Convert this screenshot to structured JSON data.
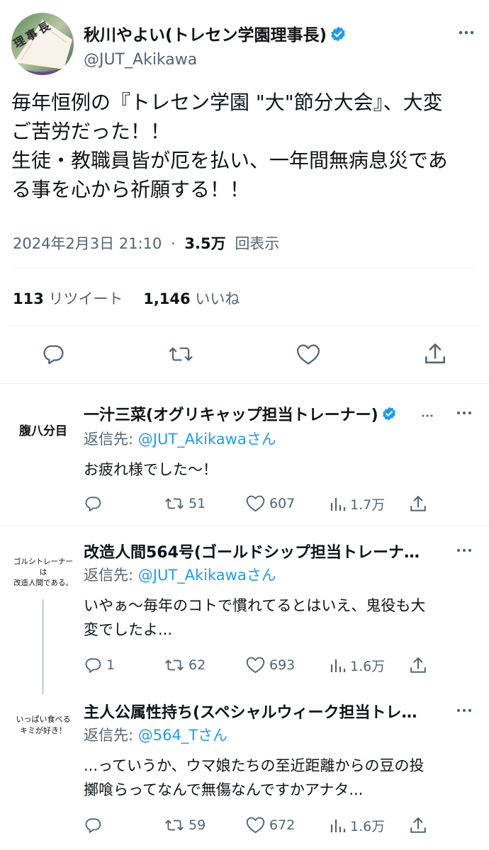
{
  "main_tweet": {
    "author_name": "秋川やよい(トレセン学園理事長)",
    "handle": "@JUT_Akikawa",
    "avatar_text": "理事長",
    "text_lines": [
      "毎年恒例の『トレセン学園 \"大\"節分大会』、大変",
      "ご苦労だった！！",
      "生徒・教職員皆が厄を払い、一年間無病息災であ",
      "る事を心から祈願する！！"
    ],
    "timestamp": "2024年2月3日 21:10",
    "separator": "·",
    "views_count": "3.5万",
    "views_label": "回表示",
    "retweets_count": "113",
    "retweets_label": "リツイート",
    "likes_count": "1,146",
    "likes_label": "いいね"
  },
  "replies": [
    {
      "author_name": "一汁三菜(オグリキャップ担当トレーナー)",
      "verified": true,
      "avatar_text": "腹八分目",
      "reply_prefix": "返信先: ",
      "reply_to": "@JUT_Akikawaさん",
      "text_lines": [
        "お疲れ様でした〜！"
      ],
      "replies": "",
      "retweets": "51",
      "likes": "607",
      "views": "1.7万"
    },
    {
      "author_name": "改造人間564号(ゴールドシップ担当トレーナ…",
      "verified": false,
      "avatar_text_lines": [
        "ゴルシトレーナーは",
        "改造人間である。"
      ],
      "reply_prefix": "返信先: ",
      "reply_to": "@JUT_Akikawaさん",
      "text_lines": [
        "いやぁ〜毎年のコトで慣れてるとはいえ、鬼役も大",
        "変でしたよ..."
      ],
      "replies": "1",
      "retweets": "62",
      "likes": "693",
      "views": "1.6万"
    },
    {
      "author_name": "主人公属性持ち(スペシャルウィーク担当トレ…",
      "verified": false,
      "avatar_text_lines": [
        "いっぱい食べる",
        "キミが好き！"
      ],
      "reply_prefix": "返信先: ",
      "reply_to": "@564_Tさん",
      "text_lines": [
        "...っていうか、ウマ娘たちの至近距離からの豆の投",
        "擲喰らってなんで無傷なんですかアナタ..."
      ],
      "replies": "",
      "retweets": "59",
      "likes": "672",
      "views": "1.6万"
    }
  ],
  "icons": {
    "reply": "reply-icon",
    "retweet": "retweet-icon",
    "like": "heart-icon",
    "share": "share-icon",
    "views": "views-icon",
    "more": "more-icon",
    "verified": "verified-badge-icon"
  },
  "colors": {
    "accent": "#1d9bf0",
    "text": "#0f1419",
    "muted": "#536471"
  }
}
